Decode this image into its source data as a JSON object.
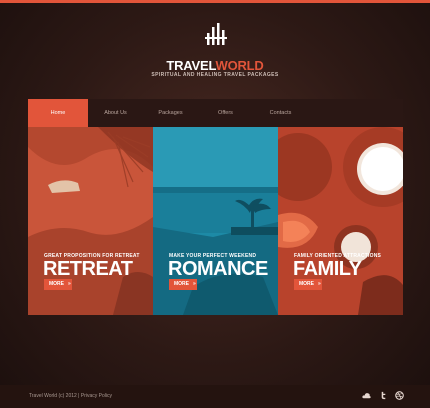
{
  "brand": {
    "name_part1": "TRAVEL",
    "name_part2": "WORLD",
    "tagline": "SPIRITUAL AND HEALING TRAVEL PACKAGES"
  },
  "nav": {
    "items": [
      {
        "label": "Home"
      },
      {
        "label": "About Us"
      },
      {
        "label": "Packages"
      },
      {
        "label": "Offers"
      },
      {
        "label": "Contacts"
      }
    ],
    "active_index": 0
  },
  "panels": [
    {
      "subtitle": "GREAT PROPOSITION FOR RETREAT",
      "title": "RETREAT",
      "button": "MORE",
      "tint": "#d0583c"
    },
    {
      "subtitle": "MAKE YOUR PERFECT WEEKEND",
      "title": "ROMANCE",
      "button": "MORE",
      "tint": "#1d8aa6"
    },
    {
      "subtitle": "FAMILY ORIENTED ATTRACTIONS",
      "title": "FAMILY",
      "button": "MORE",
      "tint": "#c94b33"
    }
  ],
  "footer": {
    "copyright": "Travel World (c) 2012  |  Privacy Policy",
    "social": [
      "cloud-icon",
      "twitter-icon",
      "dribbble-icon"
    ]
  },
  "colors": {
    "accent": "#e2553a",
    "background": "#2d1915",
    "nav_bg": "#2a1714"
  }
}
